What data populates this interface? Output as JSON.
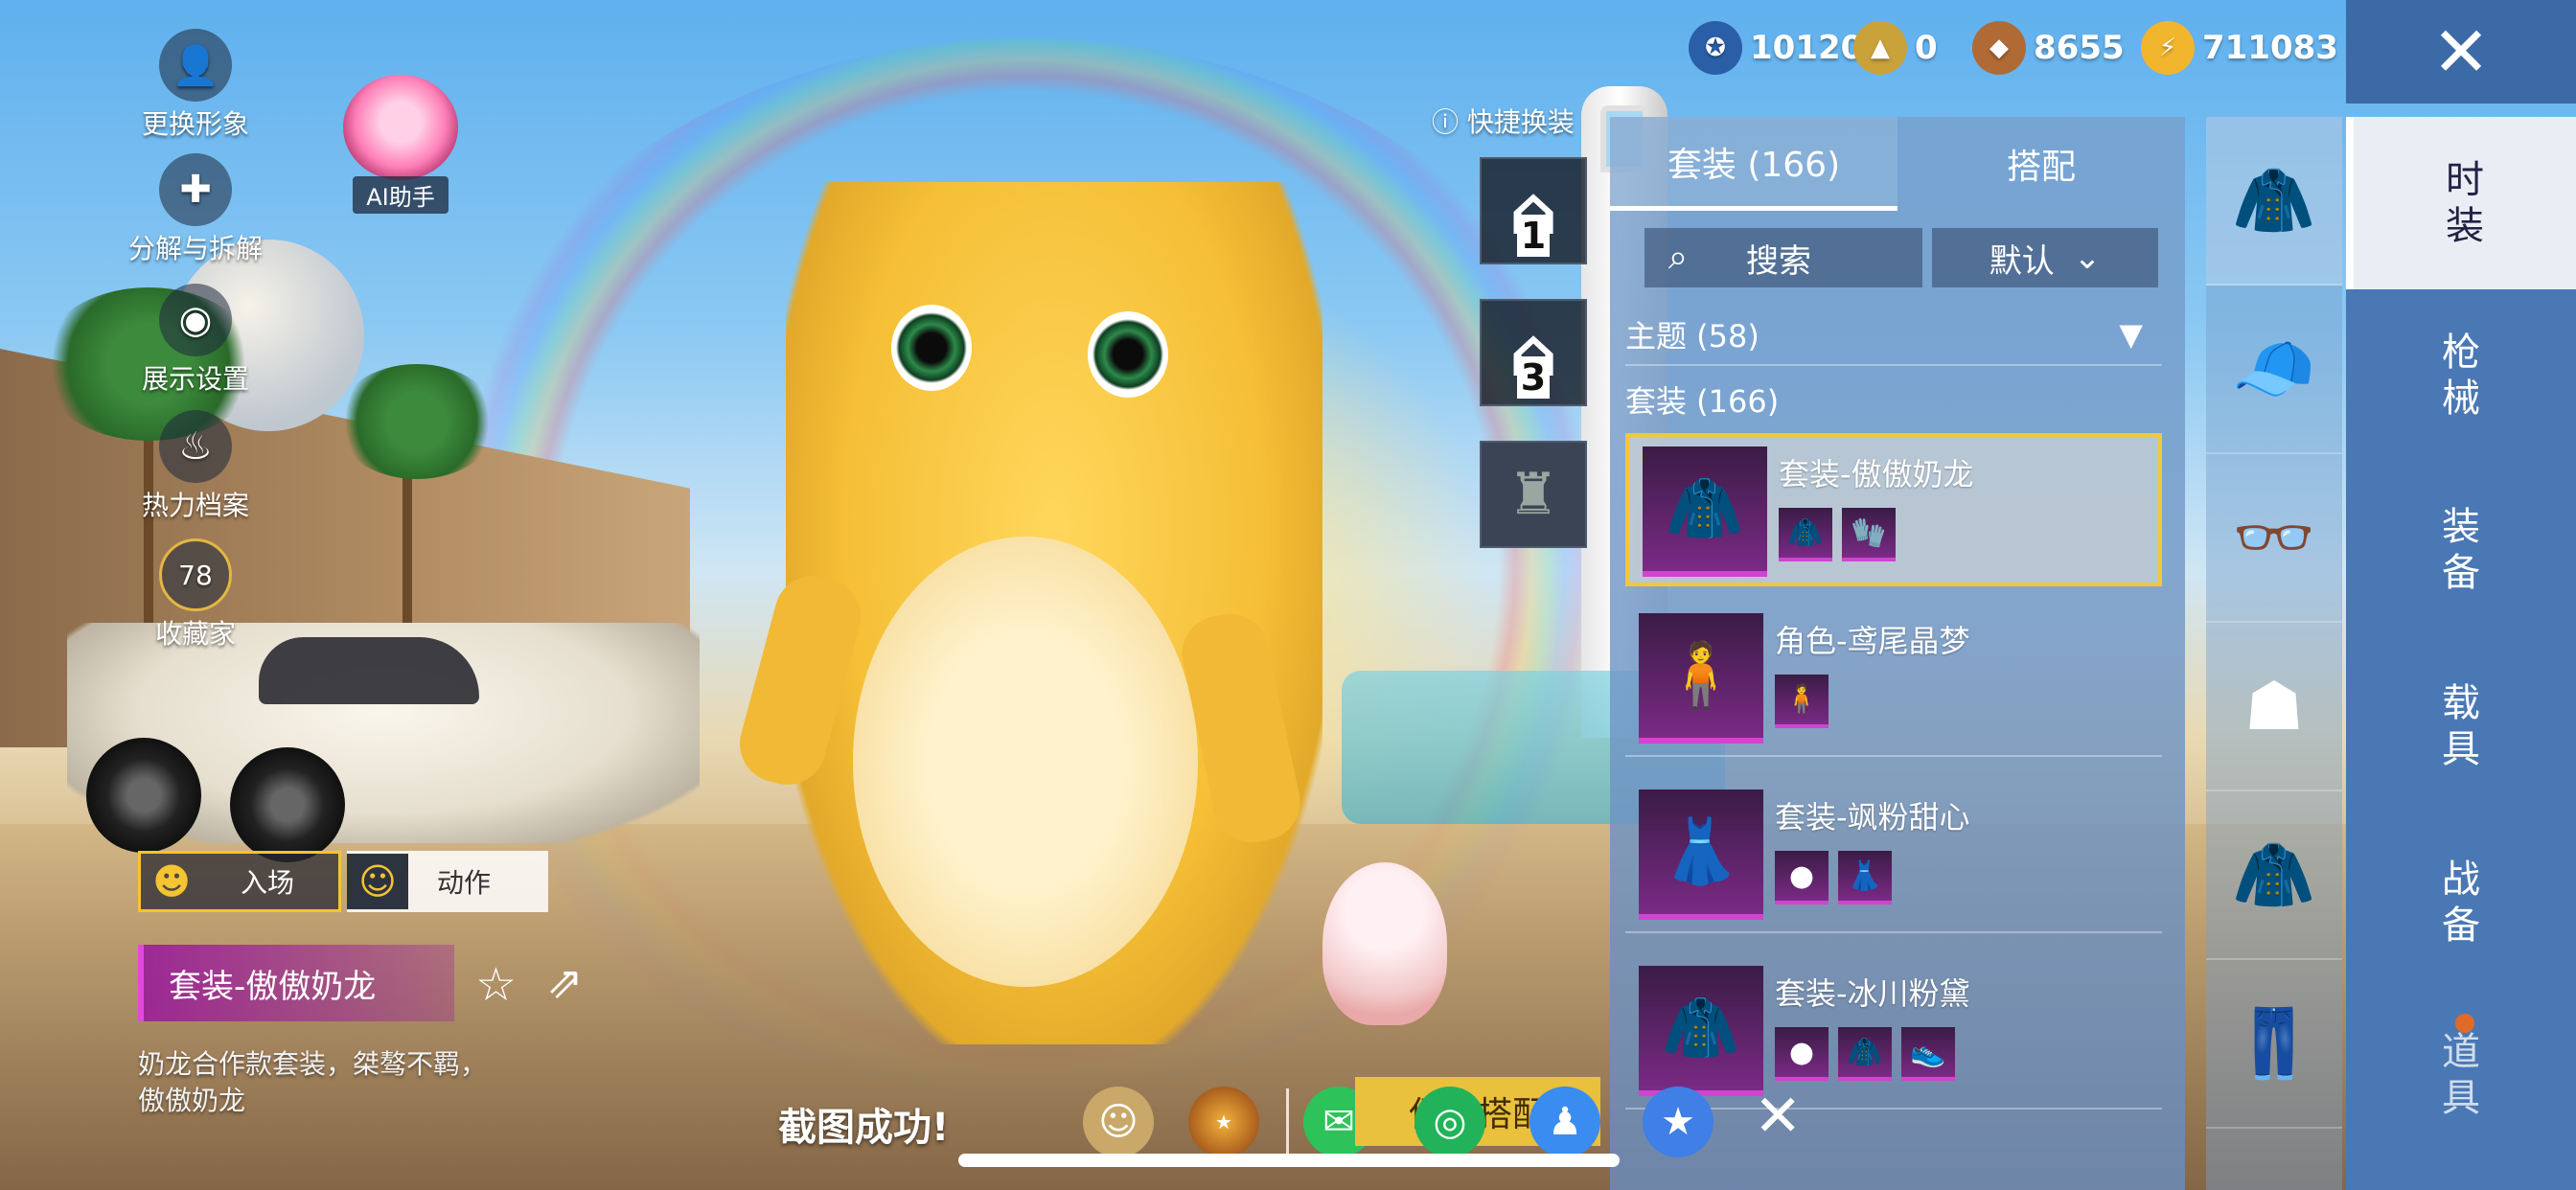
{
  "currencies": [
    {
      "icon": "medal-coin-icon",
      "value": "10120",
      "color": "#2a5fa8"
    },
    {
      "icon": "gold-token-icon",
      "value": "0",
      "color": "#c9a23a"
    },
    {
      "icon": "bronze-coin-icon",
      "value": "8655",
      "color": "#b06a35"
    },
    {
      "icon": "lightning-coin-icon",
      "value": "711083",
      "color": "#f1b52e"
    }
  ],
  "close_label": "✕",
  "left_tools": [
    {
      "name": "change-avatar",
      "label": "更换形象",
      "icon": "person-icon"
    },
    {
      "name": "decompose",
      "label": "分解与拆解",
      "icon": "puzzle-icon"
    },
    {
      "name": "display-settings",
      "label": "展示设置",
      "icon": "eye-icon"
    },
    {
      "name": "heat-profile",
      "label": "热力档案",
      "icon": "flame-icon"
    },
    {
      "name": "collection",
      "label": "收藏家",
      "icon": "badge-icon",
      "badge": "78"
    }
  ],
  "ai_assistant": {
    "label": "AI助手"
  },
  "entry_button": {
    "label": "入场"
  },
  "action_button": {
    "label": "动作"
  },
  "current_set": {
    "title": "套装-傲傲奶龙",
    "description_line1": "奶龙合作款套装，桀骜不羁，",
    "description_line2": "傲傲奶龙"
  },
  "quick_change": {
    "label": "快捷换装",
    "slots": [
      "1",
      "3"
    ]
  },
  "panel": {
    "tabs": [
      "套装 (166)",
      "搭配"
    ],
    "search_placeholder": "搜索",
    "sort_label": "默认",
    "theme_label": "主题 (58)",
    "suit_header": "套装 (166)",
    "items": [
      {
        "name": "套装-傲傲奶龙",
        "selected": true,
        "sub_count": 2
      },
      {
        "name": "角色-鸢尾晶梦",
        "selected": false,
        "sub_count": 1
      },
      {
        "name": "套装-飒粉甜心",
        "selected": false,
        "sub_count": 2
      },
      {
        "name": "套装-冰川粉黛",
        "selected": false,
        "sub_count": 3
      }
    ]
  },
  "icon_column": [
    "outfit-icon",
    "cap-icon",
    "glasses-icon",
    "mask-icon",
    "outfit-icon",
    "pants-icon"
  ],
  "categories": [
    {
      "line1": "时",
      "line2": "装",
      "active": true
    },
    {
      "line1": "枪",
      "line2": "械",
      "active": false
    },
    {
      "line1": "装",
      "line2": "备",
      "active": false
    },
    {
      "line1": "载",
      "line2": "具",
      "active": false
    },
    {
      "line1": "战",
      "line2": "备",
      "active": false
    },
    {
      "line1": "道",
      "line2": "具",
      "active": false
    }
  ],
  "share_bar": {
    "toast": "截图成功!",
    "save_label": "保存搭配",
    "icons": [
      "profile-share-icon",
      "game-logo-icon",
      "wechat-icon",
      "moments-icon",
      "qq-icon",
      "qzone-icon"
    ]
  }
}
